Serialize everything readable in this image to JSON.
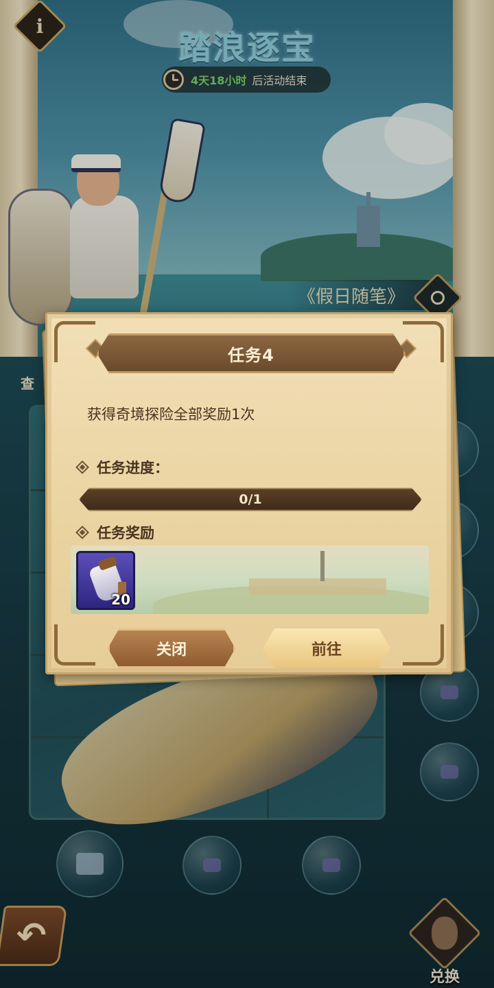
{
  "event": {
    "title": "踏浪逐宝",
    "timer_value": "4天18小时",
    "timer_suffix": "后活动结束",
    "info_label": "i",
    "chapter_title": "《假日随笔》",
    "view_label": "查"
  },
  "modal": {
    "title": "任务4",
    "description": "获得奇境探险全部奖励1次",
    "progress_label": "任务进度：",
    "progress_text": "0/1",
    "progress_current": 0,
    "progress_total": 1,
    "reward_label": "任务奖励",
    "rewards": [
      {
        "icon": "potion-bottle-icon",
        "quantity": "20"
      }
    ],
    "close_button": "关闭",
    "go_button": "前往"
  },
  "bottom": {
    "back_icon": "back-arrow-icon",
    "exchange_label": "兑换"
  },
  "colors": {
    "modal_bg": "#f1dfb6",
    "title_bar": "#7a5734",
    "timer_accent": "#79d36a",
    "go_button": "#f3d898",
    "close_button": "#a4703f"
  }
}
